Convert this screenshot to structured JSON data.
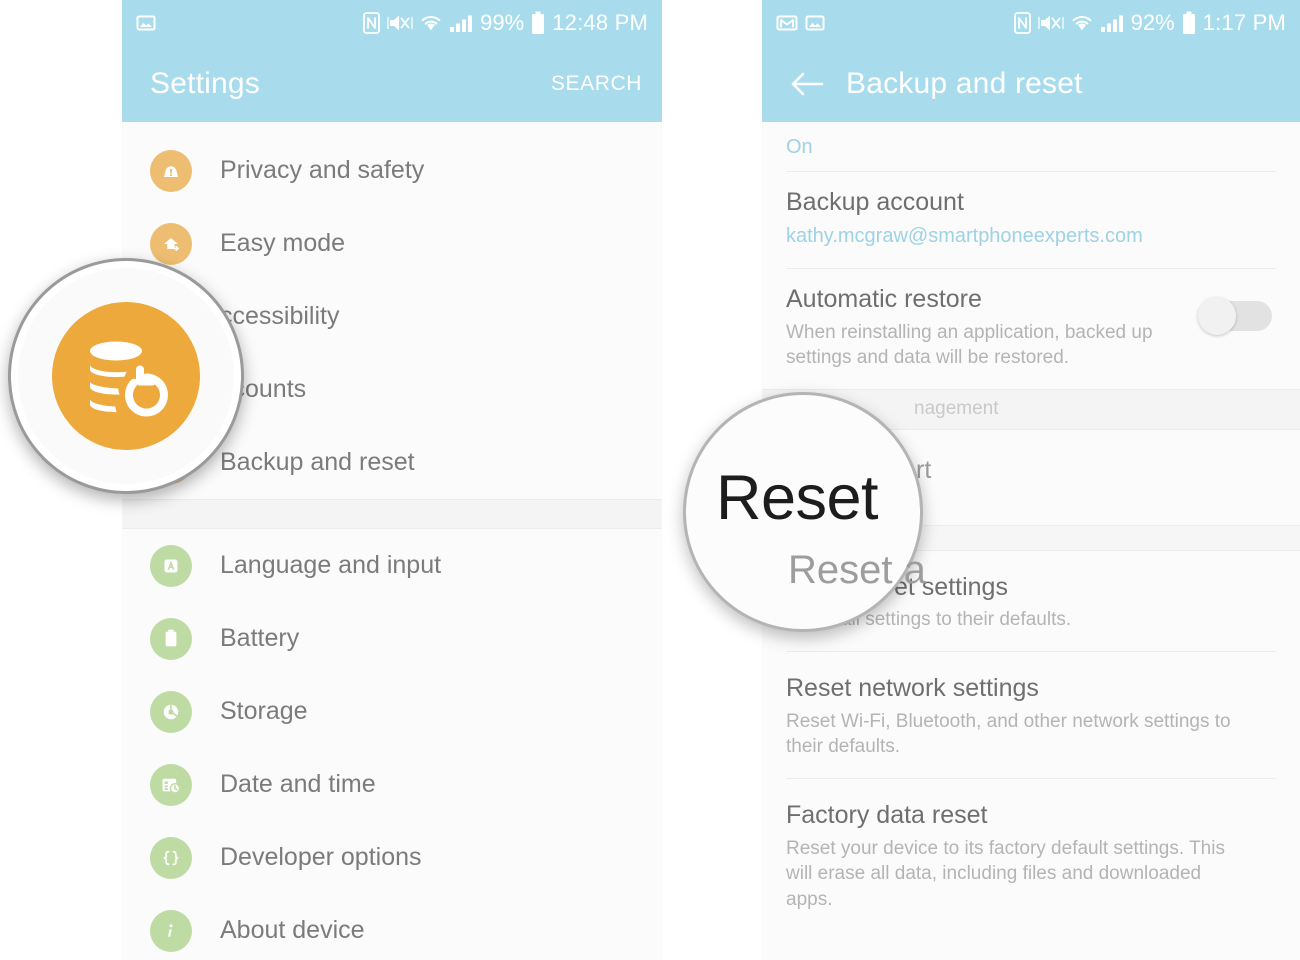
{
  "left_phone": {
    "status_bar": {
      "left_icons": [
        "image-icon"
      ],
      "right_icons": [
        "nfc-icon",
        "mute-vibrate-icon",
        "wifi-icon",
        "signal-bars-icon",
        "battery-icon"
      ],
      "battery_percent": "99%",
      "time": "12:48 PM"
    },
    "app_bar": {
      "title": "Settings",
      "action_label": "SEARCH"
    },
    "items_group_1": [
      {
        "label": "Privacy and safety",
        "icon": "privacy-lock-icon",
        "badge": "orange"
      },
      {
        "label": "Easy mode",
        "icon": "easy-mode-icon",
        "badge": "orange"
      },
      {
        "label": "Accessibility",
        "icon": "accessibility-icon",
        "badge": "orange",
        "truncated": "ccessibility"
      },
      {
        "label": "Accounts",
        "icon": "accounts-icon",
        "badge": "orange",
        "truncated": "ccounts"
      },
      {
        "label": "Backup and reset",
        "icon": "backup-reset-icon",
        "badge": "orange"
      }
    ],
    "items_group_2": [
      {
        "label": "Language and input",
        "icon": "language-icon",
        "badge": "green"
      },
      {
        "label": "Battery",
        "icon": "battery-icon",
        "badge": "green"
      },
      {
        "label": "Storage",
        "icon": "storage-icon",
        "badge": "green"
      },
      {
        "label": "Date and time",
        "icon": "date-time-icon",
        "badge": "green"
      },
      {
        "label": "Developer options",
        "icon": "developer-options-icon",
        "badge": "green"
      },
      {
        "label": "About device",
        "icon": "about-device-icon",
        "badge": "green"
      }
    ],
    "magnifier": {
      "icon": "backup-reset-icon",
      "icon_color": "#eda93c"
    }
  },
  "right_phone": {
    "status_bar": {
      "left_icons": [
        "gmail-icon",
        "image-icon"
      ],
      "right_icons": [
        "nfc-icon",
        "mute-vibrate-icon",
        "wifi-icon",
        "signal-bars-icon",
        "battery-icon"
      ],
      "battery_percent": "92%",
      "time": "1:17 PM"
    },
    "app_bar": {
      "back_icon": "back-arrow-icon",
      "title": "Backup and reset"
    },
    "top_partial_value": "On",
    "items": [
      {
        "title": "Backup account",
        "subtitle": "kathy.mcgraw@smartphoneexperts.com",
        "subtitle_style": "blue"
      },
      {
        "title": "Automatic restore",
        "subtitle": "When reinstalling an application, backed up settings and data will be restored.",
        "toggle": "off"
      }
    ],
    "section_header": "Personal data management",
    "section_header_visible": "nagement",
    "obscured_item": "Smart switch",
    "obscured_item_visible": "rt",
    "reset_items": [
      {
        "title": "Reset settings",
        "title_visible": "et settings",
        "subtitle": "Reset all settings to their defaults."
      },
      {
        "title": "Reset network settings",
        "subtitle": "Reset Wi-Fi, Bluetooth, and other network settings to their defaults."
      },
      {
        "title": "Factory data reset",
        "subtitle": "Reset your device to its factory default settings. This will erase all data, including files and downloaded apps."
      }
    ],
    "magnifier": {
      "word": "Reset",
      "bleed_word": "Reset a"
    }
  },
  "colors": {
    "status_bar": "#a8dced",
    "app_bar": "#a8dced",
    "badge_orange": "#edbe72",
    "badge_green": "#bedba4",
    "magnifier_icon": "#eda93c",
    "body_text": "#7b7b7b",
    "sub_text": "#b4b4b4",
    "accent_blue": "#9ed2e4"
  }
}
